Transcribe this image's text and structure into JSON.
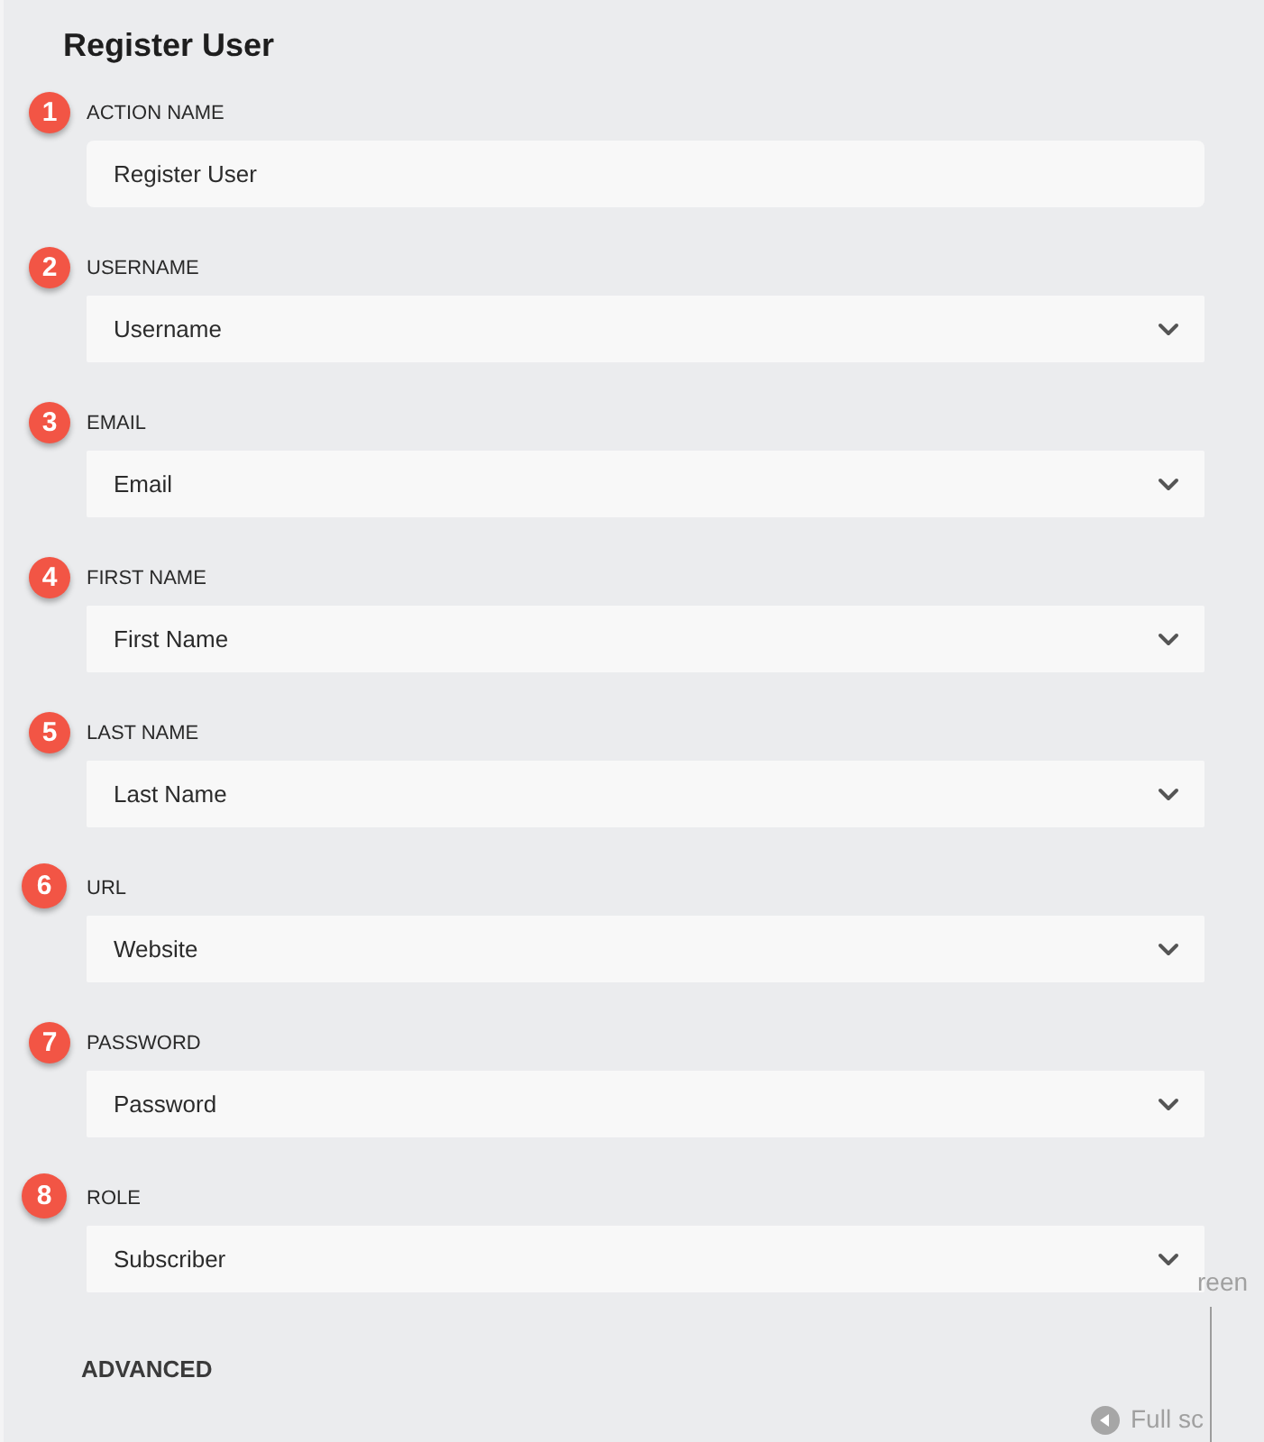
{
  "title": "Register User",
  "fields": [
    {
      "badge": "1",
      "label": "ACTION NAME",
      "kind": "text",
      "value": "Register User"
    },
    {
      "badge": "2",
      "label": "USERNAME",
      "kind": "select",
      "value": "Username"
    },
    {
      "badge": "3",
      "label": "EMAIL",
      "kind": "select",
      "value": "Email"
    },
    {
      "badge": "4",
      "label": "FIRST NAME",
      "kind": "select",
      "value": "First Name"
    },
    {
      "badge": "5",
      "label": "LAST NAME",
      "kind": "select",
      "value": "Last Name"
    },
    {
      "badge": "6",
      "label": "URL",
      "kind": "select",
      "value": "Website"
    },
    {
      "badge": "7",
      "label": "PASSWORD",
      "kind": "select",
      "value": "Password"
    },
    {
      "badge": "8",
      "label": "ROLE",
      "kind": "select",
      "value": "Subscriber"
    }
  ],
  "section": "ADVANCED",
  "overlay": {
    "top_text": "reen",
    "bottom_text": "Full sc"
  }
}
